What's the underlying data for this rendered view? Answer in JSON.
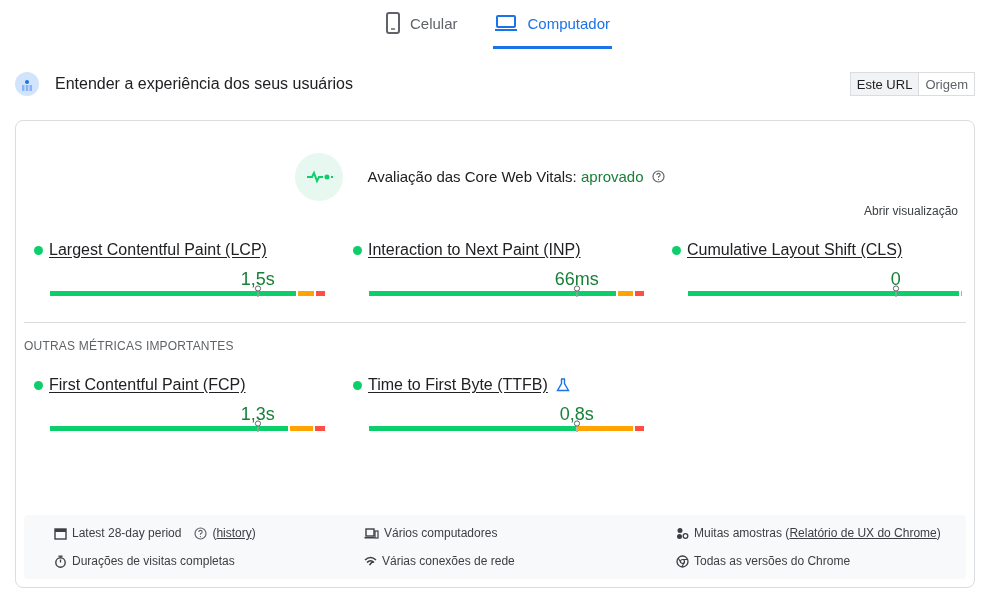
{
  "device_tabs": [
    {
      "label": "Celular",
      "selected": false
    },
    {
      "label": "Computador",
      "selected": true
    }
  ],
  "section": {
    "title": "Entender a experiência dos seus usuários",
    "scope_buttons": [
      {
        "label": "Este URL",
        "selected": true
      },
      {
        "label": "Origem",
        "selected": false
      }
    ]
  },
  "assessment": {
    "label": "Avaliação das Core Web Vitals:",
    "result": "aprovado",
    "link": "Abrir visualização"
  },
  "core_metrics": [
    {
      "name": "Largest Contentful Paint (LCP)",
      "value": "1,5s",
      "color": "#0cce6b",
      "experimental": false
    },
    {
      "name": "Interaction to Next Paint (INP)",
      "value": "66ms",
      "color": "#0cce6b",
      "experimental": false
    },
    {
      "name": "Cumulative Layout Shift (CLS)",
      "value": "0",
      "color": "#0cce6b",
      "experimental": false
    }
  ],
  "other_heading": "OUTRAS MÉTRICAS IMPORTANTES",
  "other_metrics": [
    {
      "name": "First Contentful Paint (FCP)",
      "value": "1,3s",
      "color": "#0cce6b",
      "experimental": false
    },
    {
      "name": "Time to First Byte (TTFB)",
      "value": "0,8s",
      "color": "#0cce6b",
      "experimental": true
    }
  ],
  "footer": [
    {
      "text": "Latest 28-day period",
      "help": true,
      "prefix": "(",
      "link": "history",
      "suffix": ")"
    },
    {
      "text": "Vários computadores",
      "help": false
    },
    {
      "text": "Muitas amostras",
      "help": false,
      "prefix": "(",
      "link": "Relatório de UX do Chrome",
      "suffix": ")"
    },
    {
      "text": "Durações de visitas completas",
      "help": false
    },
    {
      "text": "Várias conexões de rede",
      "help": false
    },
    {
      "text": "Todas as versões do Chrome",
      "help": false
    }
  ]
}
